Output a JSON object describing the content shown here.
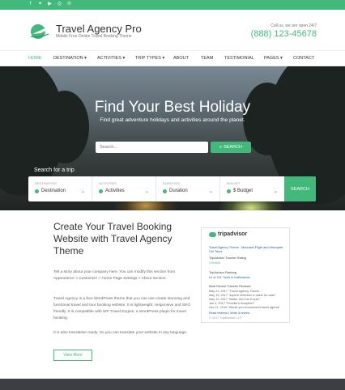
{
  "topbar": {
    "social_icons": [
      "facebook-icon",
      "twitter-icon",
      "youtube-icon",
      "instagram-icon",
      "pinterest-icon"
    ],
    "accent_color": "#42b97a"
  },
  "header": {
    "site_title": "Travel Agency Pro",
    "site_description": "Mobile Free Online Travel Booking Theme",
    "call_label": "Call us, we are open 24/7",
    "phone": "(888) 123-45678"
  },
  "nav": {
    "items": [
      {
        "label": "HOME",
        "active": true
      },
      {
        "label": "DESTINATION ▾"
      },
      {
        "label": "ACTIVITIES ▾"
      },
      {
        "label": "TRIP TYPES ▾"
      },
      {
        "label": "ABOUT"
      },
      {
        "label": "TEAM"
      },
      {
        "label": "TESTIMONIAL"
      },
      {
        "label": "PAGES ▾"
      },
      {
        "label": "CONTACT"
      }
    ]
  },
  "hero": {
    "title": "Find Your Best Holiday",
    "subtitle": "Find great adventure holidays and activities around the planet.",
    "search_placeholder": "Search...",
    "search_button": "SEARCH"
  },
  "trip_search": {
    "label": "Search for a trip",
    "fields": [
      {
        "caption": "DESTINATION",
        "value": "Destination"
      },
      {
        "caption": "ACTIVITIES",
        "value": "Activities"
      },
      {
        "caption": "DURATION",
        "value": "Duration"
      },
      {
        "caption": "BUDGET",
        "value": "$ Budget"
      }
    ],
    "button": "SEARCH"
  },
  "intro": {
    "title": "Create Your Travel Booking Website with Travel Agency Theme",
    "paragraphs": [
      "Tell a story about your company here. You can modify this section from Appearance > Customize > Home Page Settings > About Section.",
      "Travel Agency is a free WordPress theme that you can use create stunning and functional travel and tour booking website. It is lightweight, responsive and SEO friendly. It is compatible with WP Travel Engine, a WordPress plugin for travel booking.",
      "It is also translation ready. So you can translate your website in any language."
    ],
    "button": "View More"
  },
  "tripadvisor": {
    "logo": "tripadvisor",
    "link_title": "Travel Agency Theme - Mountain Flight and Helicopter Car Tours",
    "rating_label": "TripAdvisor Traveler Rating",
    "reviews_count": "1 review",
    "ranking_label": "TripAdvisor Ranking",
    "ranking": "#1 of 201 Tours in Kathmandu",
    "recent_label": "Most Recent Traveler Reviews",
    "reviews": [
      "May 21, 2017 \"Travel Agency Theme...\"",
      "May 19, 2017 \"superb selection & value for cash\"",
      "May 12, 2017 \"Better Get Our Exper!\"",
      "Jan 4, 2017 \"Excellent reception!\"",
      "Dec 11, 2016 \"Would you recommend travel agents\""
    ],
    "links": "Read reviews | Write a review",
    "copyright": "© 2017 TripAdvisor LLC"
  }
}
